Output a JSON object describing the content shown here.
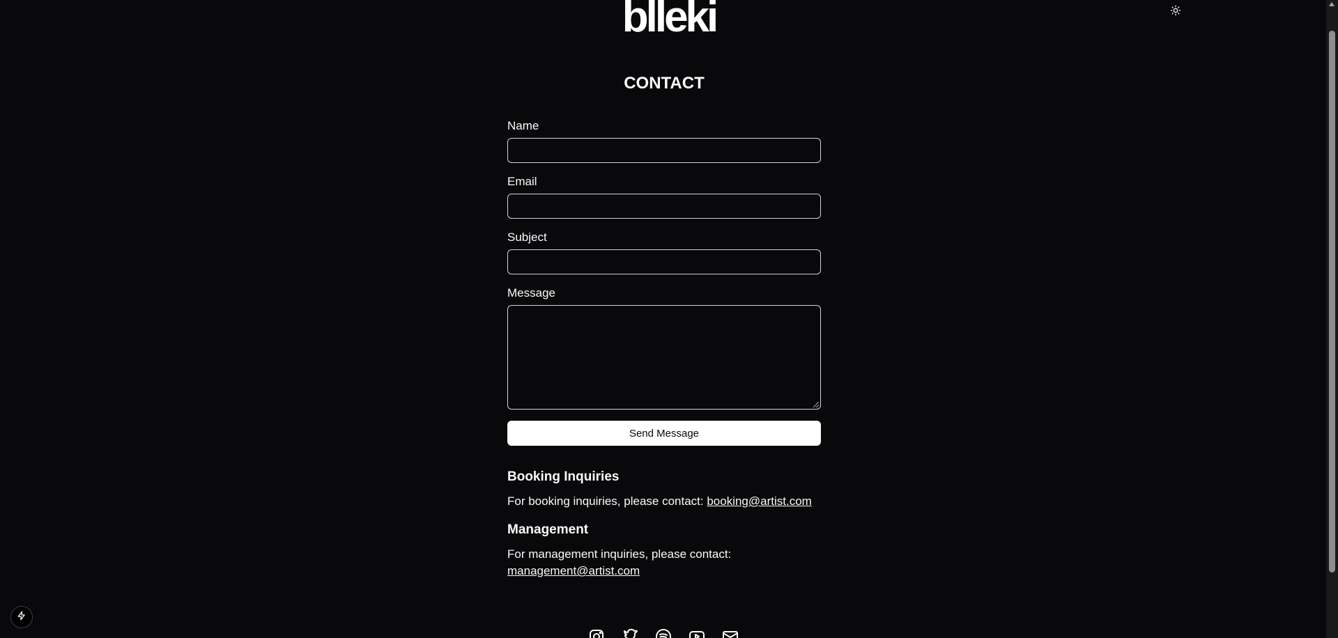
{
  "header": {
    "logo": "blleki",
    "theme_toggle_icon": "sun-icon"
  },
  "main": {
    "title": "CONTACT",
    "form": {
      "name_label": "Name",
      "name_value": "",
      "email_label": "Email",
      "email_value": "",
      "subject_label": "Subject",
      "subject_value": "",
      "message_label": "Message",
      "message_value": "",
      "submit_label": "Send Message"
    },
    "booking": {
      "heading": "Booking Inquiries",
      "text": "For booking inquiries, please contact: ",
      "email": "booking@artist.com"
    },
    "management": {
      "heading": "Management",
      "text": "For management inquiries, please contact: ",
      "email": "management@artist.com"
    }
  },
  "footer": {
    "social_icons": [
      "instagram-icon",
      "twitter-icon",
      "spotify-icon",
      "youtube-icon",
      "mail-icon"
    ]
  },
  "dev_badge_icon": "lightning-icon",
  "colors": {
    "background": "#09090b",
    "foreground": "#fafafa",
    "button_bg": "#ffffff",
    "button_text": "#09090b",
    "input_border": "#d4d4d8"
  }
}
